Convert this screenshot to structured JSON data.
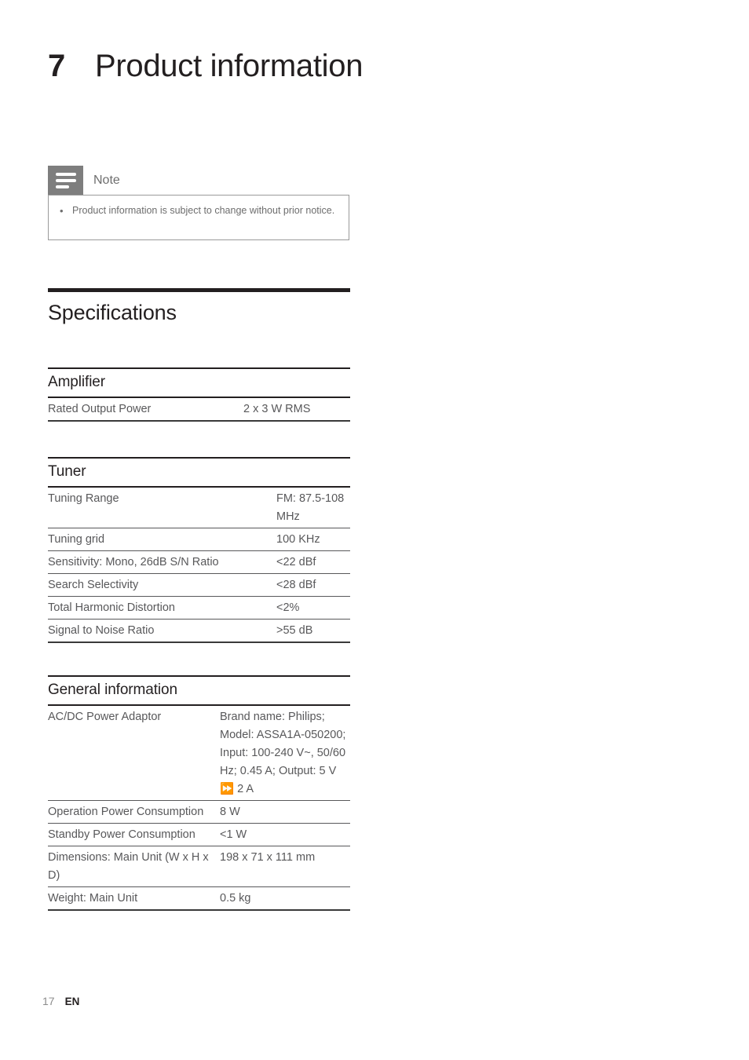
{
  "chapter": {
    "number": "7",
    "title": "Product information"
  },
  "note": {
    "icon": "note-lines-icon",
    "title": "Note",
    "bullet": "•",
    "items": [
      "Product information is subject to change without prior notice."
    ]
  },
  "specifications": {
    "heading": "Specifications",
    "sections": [
      {
        "id": "amplifier",
        "heading": "Amplifier",
        "rows": [
          {
            "key": "Rated Output Power",
            "value": "2 x 3 W RMS"
          }
        ]
      },
      {
        "id": "tuner",
        "heading": "Tuner",
        "rows": [
          {
            "key": "Tuning Range",
            "value": "FM: 87.5-108 MHz"
          },
          {
            "key": "Tuning grid",
            "value": "100 KHz"
          },
          {
            "key": "Sensitivity: Mono, 26dB S/N Ratio",
            "value": "<22 dBf"
          },
          {
            "key": "Search Selectivity",
            "value": "<28 dBf"
          },
          {
            "key": "Total Harmonic Distortion",
            "value": "<2%"
          },
          {
            "key": "Signal to Noise Ratio",
            "value": ">55 dB"
          }
        ]
      },
      {
        "id": "general-information",
        "heading": "General information",
        "rows": [
          {
            "key": "AC/DC Power Adaptor",
            "value": "Brand name: Philips; Model: ASSA1A-050200; Input: 100-240 V~, 50/60 Hz; 0.45 A; Output: 5 V ⏩ 2 A"
          },
          {
            "key": "Operation Power Consumption",
            "value": "8 W"
          },
          {
            "key": "Standby Power Consumption",
            "value": "<1 W"
          },
          {
            "key": "Dimensions: Main Unit (W x H x D)",
            "value": "198 x 71 x 111 mm"
          },
          {
            "key": "Weight: Main Unit",
            "value": "0.5 kg"
          }
        ]
      }
    ]
  },
  "footer": {
    "page_number": "17",
    "language": "EN"
  },
  "colors": {
    "ink": "#231f20",
    "body_text": "#58585a",
    "note_gray": "#7e7e7e",
    "rule": "#58585a"
  }
}
